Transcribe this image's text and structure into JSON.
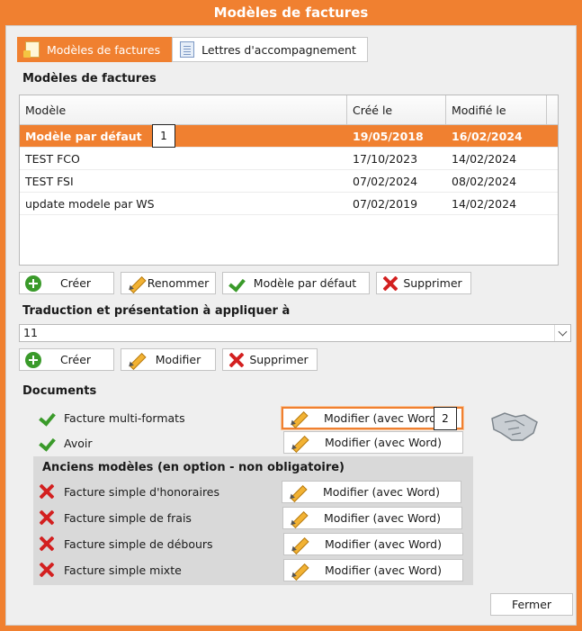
{
  "window": {
    "title": "Modèles de factures"
  },
  "tabs": [
    {
      "label": "Modèles de factures",
      "active": true
    },
    {
      "label": "Lettres d'accompagnement",
      "active": false
    }
  ],
  "models_section": {
    "title": "Modèles de factures",
    "columns": [
      "Modèle",
      "Créé le",
      "Modifié le"
    ],
    "rows": [
      {
        "name": "Modèle par défaut",
        "created": "19/05/2018",
        "modified": "16/02/2024",
        "selected": true
      },
      {
        "name": "TEST FCO",
        "created": "17/10/2023",
        "modified": "14/02/2024",
        "selected": false
      },
      {
        "name": "TEST FSI",
        "created": "07/02/2024",
        "modified": "08/02/2024",
        "selected": false
      },
      {
        "name": "update modele par WS",
        "created": "07/02/2019",
        "modified": "14/02/2024",
        "selected": false
      }
    ],
    "buttons": {
      "create": "Créer",
      "rename": "Renommer",
      "default": "Modèle par défaut",
      "delete": "Supprimer"
    }
  },
  "translation_section": {
    "title": "Traduction et présentation à appliquer à",
    "selected": "11",
    "buttons": {
      "create": "Créer",
      "modify": "Modifier",
      "delete": "Supprimer"
    }
  },
  "documents_section": {
    "title": "Documents",
    "items": [
      {
        "label": "Facture multi-formats",
        "status": "ok",
        "button": "Modifier (avec Word)"
      },
      {
        "label": "Avoir",
        "status": "ok",
        "button": "Modifier (avec Word)"
      }
    ],
    "legacy_title": "Anciens modèles (en option - non obligatoire)",
    "legacy_items": [
      {
        "label": "Facture simple d'honoraires",
        "status": "missing",
        "button": "Modifier (avec Word)"
      },
      {
        "label": "Facture simple de frais",
        "status": "missing",
        "button": "Modifier (avec Word)"
      },
      {
        "label": "Facture simple de débours",
        "status": "missing",
        "button": "Modifier (avec Word)"
      },
      {
        "label": "Facture simple mixte",
        "status": "missing",
        "button": "Modifier (avec Word)"
      }
    ]
  },
  "callouts": {
    "first": "1",
    "second": "2"
  },
  "footer": {
    "close": "Fermer"
  },
  "icons": [
    "document-icon",
    "letters-icon",
    "plus-icon",
    "pencil-icon",
    "check-icon",
    "cross-icon",
    "handshake-icon"
  ],
  "colors": {
    "accent": "#f08030",
    "success": "#3a9a2a",
    "danger": "#d32020"
  }
}
